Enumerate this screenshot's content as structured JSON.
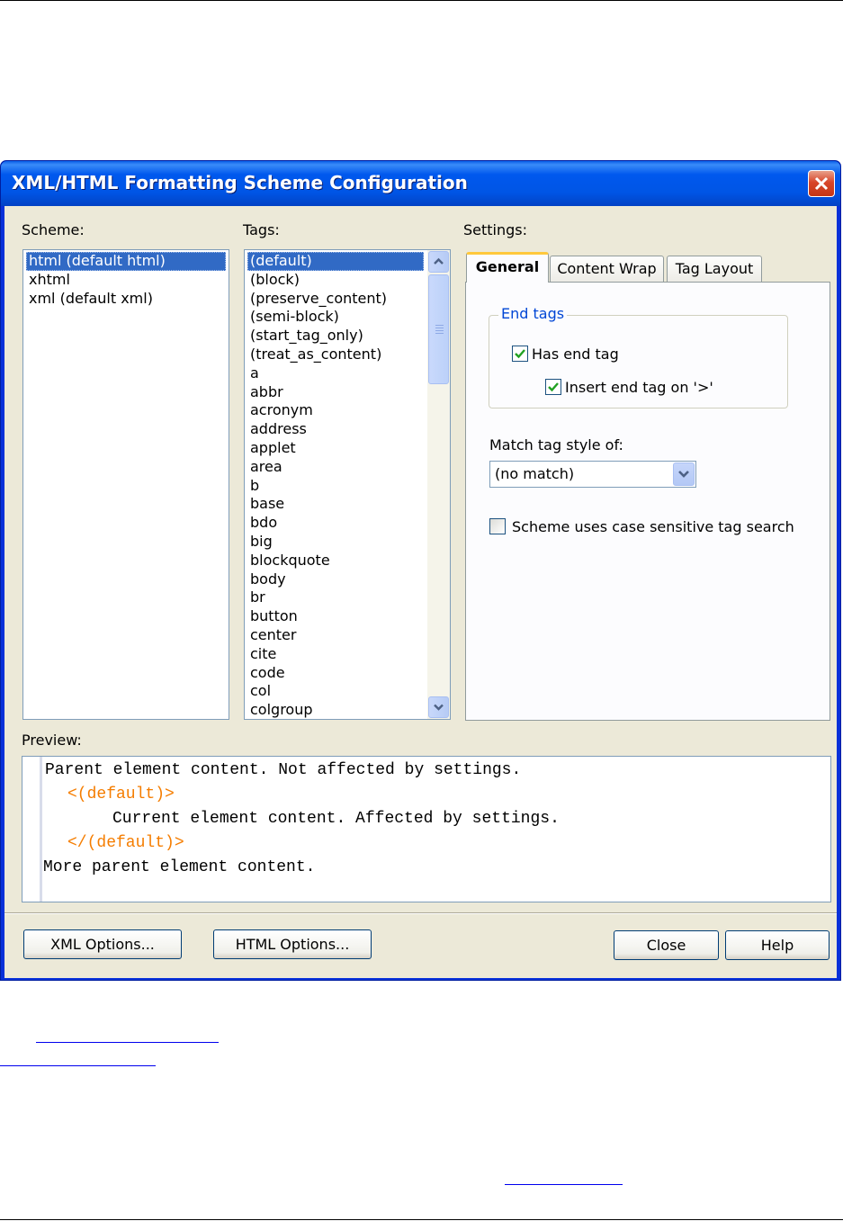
{
  "dialog": {
    "title": "XML/HTML Formatting Scheme Configuration"
  },
  "scheme": {
    "label": "Scheme:",
    "items": [
      "html (default html)",
      "xhtml",
      "xml (default xml)"
    ],
    "selected_index": 0
  },
  "tags": {
    "label": "Tags:",
    "items": [
      "(default)",
      "(block)",
      "(preserve_content)",
      "(semi-block)",
      "(start_tag_only)",
      "(treat_as_content)",
      "a",
      "abbr",
      "acronym",
      "address",
      "applet",
      "area",
      "b",
      "base",
      "bdo",
      "big",
      "blockquote",
      "body",
      "br",
      "button",
      "center",
      "cite",
      "code",
      "col",
      "colgroup"
    ],
    "selected_index": 0
  },
  "settings": {
    "label": "Settings:",
    "tabs": [
      "General",
      "Content Wrap",
      "Tag Layout"
    ],
    "active_tab": 0,
    "end_tags_group": "End tags",
    "has_end_tag": {
      "label": "Has end tag",
      "checked": true
    },
    "insert_end_tag": {
      "label": "Insert end tag on '>'",
      "checked": true
    },
    "match_tag_label": "Match tag style of:",
    "match_tag_value": "(no match)",
    "case_sensitive": {
      "label": "Scheme uses case sensitive tag search",
      "checked": false
    }
  },
  "preview": {
    "label": "Preview:",
    "line1": "Parent element content. Not affected by settings.",
    "line2": "<(default)>",
    "line3": "Current element content. Affected by settings.",
    "line4": "</(default)>",
    "line5": "More parent element content."
  },
  "buttons": {
    "xml_options": "XML Options...",
    "html_options": "HTML Options...",
    "close": "Close",
    "help": "Help"
  },
  "colors": {
    "titlebar": "#0055e5",
    "selection": "#316ac5",
    "preview_tag": "#f57d00",
    "group_title": "#0046d5"
  }
}
